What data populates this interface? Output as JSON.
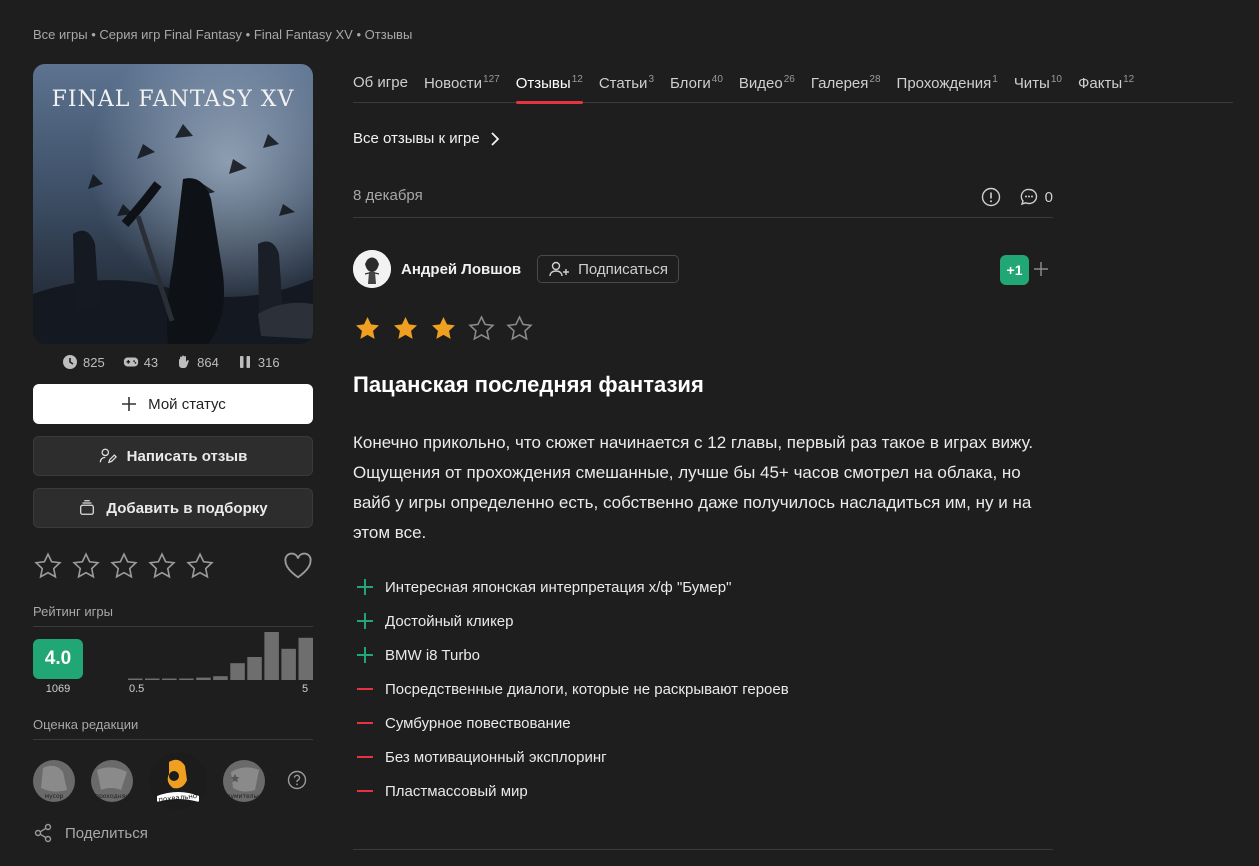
{
  "breadcrumb": [
    "Все игры",
    "Серия игр Final Fantasy",
    "Final Fantasy XV",
    "Отзывы"
  ],
  "breadcrumb_sep": "•",
  "cover": {
    "logo_text": "FINAL FANTASY XV"
  },
  "stats": {
    "playing": "825",
    "played": "43",
    "wishlist": "864",
    "paused": "316"
  },
  "buttons": {
    "status": "Мой статус",
    "write_review": "Написать отзыв",
    "add_collection": "Добавить в подборку"
  },
  "game_rating": {
    "label": "Рейтинг игры",
    "value": "4.0",
    "count": "1069",
    "hist_min": "0.5",
    "hist_max": "5",
    "histogram": [
      0.02,
      0.02,
      0.03,
      0.03,
      0.05,
      0.08,
      0.35,
      0.48,
      1.0,
      0.65,
      0.88
    ]
  },
  "editorial": {
    "label": "Оценка редакции",
    "badges": [
      "мусор",
      "проходняк",
      "похвально",
      "изумительно"
    ],
    "selected": "похвально"
  },
  "share_label": "Поделиться",
  "tabs": [
    {
      "label": "Об игре",
      "count": ""
    },
    {
      "label": "Новости",
      "count": "127"
    },
    {
      "label": "Отзывы",
      "count": "12"
    },
    {
      "label": "Статьи",
      "count": "3"
    },
    {
      "label": "Блоги",
      "count": "40"
    },
    {
      "label": "Видео",
      "count": "26"
    },
    {
      "label": "Галерея",
      "count": "28"
    },
    {
      "label": "Прохождения",
      "count": "1"
    },
    {
      "label": "Читы",
      "count": "10"
    },
    {
      "label": "Факты",
      "count": "12"
    }
  ],
  "active_tab": "Отзывы",
  "all_reviews_link": "Все отзывы к игре",
  "review": {
    "date": "8 декабря",
    "comments": "0",
    "author": "Андрей Ловшов",
    "subscribe": "Подписаться",
    "vote": "+1",
    "stars": 3,
    "stars_max": 5,
    "title": "Пацанская последняя фантазия",
    "body": "Конечно прикольно, что сюжет начинается с 12 главы, первый раз такое в играх вижу. Ощущения от прохождения смешанные, лучше бы 45+ часов смотрел на облака, но вайб у игры определенно есть, собственно даже получилось насладиться им, ну и на этом все.",
    "pros": [
      "Интересная японская интерпретация х/ф \"Бумер\"",
      "Достойный кликер",
      "BMW i8 Turbo"
    ],
    "cons": [
      "Посредственные диалоги, которые не раскрывают героев",
      "Сумбурное повествование",
      "Без мотивационный эксплоринг",
      "Пластмассовый мир"
    ]
  },
  "colors": {
    "accent_red": "#e5343d",
    "accent_green": "#21a675",
    "star_gold": "#f0a020",
    "bg": "#1e1e1e"
  }
}
